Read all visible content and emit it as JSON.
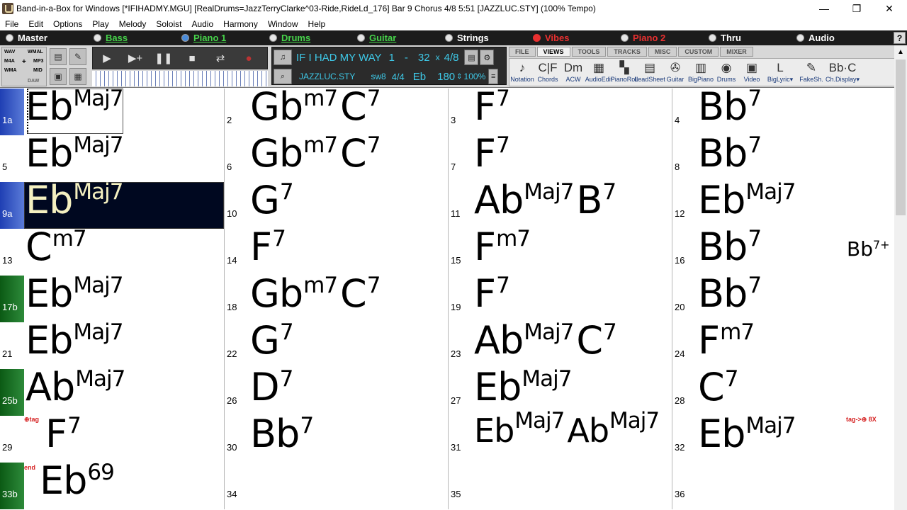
{
  "window": {
    "title": "Band-in-a-Box for Windows  [*IFIHADMY.MGU] [RealDrums=JazzTerryClarke^03-Ride,RideLd_176] Bar 9 Chorus 4/8   5:51  [JAZZLUC.STY] (100% Tempo)",
    "minimize": "—",
    "restore": "❐",
    "close": "✕"
  },
  "menu": [
    "File",
    "Edit",
    "Options",
    "Play",
    "Melody",
    "Soloist",
    "Audio",
    "Harmony",
    "Window",
    "Help"
  ],
  "tracks": [
    {
      "label": "Master",
      "color": "#ffffff",
      "state": "off"
    },
    {
      "label": "Bass",
      "color": "#46d24a",
      "state": "off"
    },
    {
      "label": "Piano 1",
      "color": "#46d24a",
      "state": "on"
    },
    {
      "label": "Drums",
      "color": "#46d24a",
      "state": "off"
    },
    {
      "label": "Guitar",
      "color": "#46d24a",
      "state": "off"
    },
    {
      "label": "Strings",
      "color": "#ffffff",
      "state": "off"
    },
    {
      "label": "Vibes",
      "color": "#e83030",
      "state": "red"
    },
    {
      "label": "Piano 2",
      "color": "#e83030",
      "state": "off"
    },
    {
      "label": "Thru",
      "color": "#ffffff",
      "state": "off"
    },
    {
      "label": "Audio",
      "color": "#ffffff",
      "state": "off"
    }
  ],
  "help_label": "?",
  "formats": {
    "wav": "WAV",
    "wmal": "WMAL",
    "m4a": "M4A",
    "plus": "+",
    "mp3": "MP3",
    "wma": "WMA",
    "mid": "MID",
    "daw": "DAW"
  },
  "song": {
    "title": "IF I HAD MY WAY",
    "start": "1",
    "dash": "-",
    "end": "32",
    "x": "x",
    "choruses": "4/8",
    "style": "JAZZLUC.STY",
    "feel": "sw8",
    "time_sig": "4/4",
    "key": "Eb",
    "tempo": "180",
    "tempo_pct": "100%"
  },
  "view_tabs": [
    "FILE",
    "VIEWS",
    "TOOLS",
    "TRACKS",
    "MISC",
    "CUSTOM",
    "MIXER"
  ],
  "active_view_tab": "VIEWS",
  "view_buttons": [
    {
      "label": "Notation",
      "glyph": "♪"
    },
    {
      "label": "Chords",
      "glyph": "C|F"
    },
    {
      "label": "ACW",
      "glyph": "Dm"
    },
    {
      "label": "AudioEdit",
      "glyph": "▦"
    },
    {
      "label": "PianoRoll",
      "glyph": "▚"
    },
    {
      "label": "LeadSheet",
      "glyph": "▤"
    },
    {
      "label": "Guitar",
      "glyph": "✇"
    },
    {
      "label": "BigPiano",
      "glyph": "▥"
    },
    {
      "label": "Drums",
      "glyph": "◉"
    },
    {
      "label": "Video",
      "glyph": "▣"
    },
    {
      "label": "BigLyric▾",
      "glyph": "L"
    },
    {
      "label": "FakeSh.",
      "glyph": "✎"
    },
    {
      "label": "Ch.Display▾",
      "glyph": "Bb·C"
    }
  ],
  "grid": {
    "rows": [
      {
        "section": "blue",
        "cells": [
          {
            "bar": "1a",
            "root": "Eb",
            "ext": "Maj7"
          },
          {
            "bar": "2",
            "root": "Gb",
            "ext": "m7",
            "root2": "C",
            "ext2": "7"
          },
          {
            "bar": "3",
            "root": "F",
            "ext": "7"
          },
          {
            "bar": "4",
            "root": "Bb",
            "ext": "7"
          }
        ]
      },
      {
        "section": "",
        "cells": [
          {
            "bar": "5",
            "root": "Eb",
            "ext": "Maj7"
          },
          {
            "bar": "6",
            "root": "Gb",
            "ext": "m7",
            "root2": "C",
            "ext2": "7"
          },
          {
            "bar": "7",
            "root": "F",
            "ext": "7"
          },
          {
            "bar": "8",
            "root": "Bb",
            "ext": "7"
          }
        ]
      },
      {
        "section": "blue",
        "highlight": true,
        "cells": [
          {
            "bar": "9a",
            "root": "Eb",
            "ext": "Maj7"
          },
          {
            "bar": "10",
            "root": "G",
            "ext": "7"
          },
          {
            "bar": "11",
            "root": "Ab",
            "ext": "Maj7",
            "root2": "B",
            "ext2": "7"
          },
          {
            "bar": "12",
            "root": "Eb",
            "ext": "Maj7"
          }
        ]
      },
      {
        "section": "",
        "cells": [
          {
            "bar": "13",
            "root": "C",
            "ext": "m7"
          },
          {
            "bar": "14",
            "root": "F",
            "ext": "7"
          },
          {
            "bar": "15",
            "root": "F",
            "ext": "m7"
          },
          {
            "bar": "16",
            "root": "Bb",
            "ext": "7"
          }
        ]
      },
      {
        "section": "green",
        "cells": [
          {
            "bar": "17b",
            "root": "Eb",
            "ext": "Maj7"
          },
          {
            "bar": "18",
            "root": "Gb",
            "ext": "m7",
            "root2": "C",
            "ext2": "7"
          },
          {
            "bar": "19",
            "root": "F",
            "ext": "7"
          },
          {
            "bar": "20",
            "root": "Bb",
            "ext": "7"
          }
        ]
      },
      {
        "section": "",
        "cells": [
          {
            "bar": "21",
            "root": "Eb",
            "ext": "Maj7"
          },
          {
            "bar": "22",
            "root": "G",
            "ext": "7"
          },
          {
            "bar": "23",
            "root": "Ab",
            "ext": "Maj7",
            "root2": "C",
            "ext2": "7"
          },
          {
            "bar": "24",
            "root": "F",
            "ext": "m7"
          }
        ]
      },
      {
        "section": "green",
        "cells": [
          {
            "bar": "25b",
            "root": "Ab",
            "ext": "Maj7"
          },
          {
            "bar": "26",
            "root": "D",
            "ext": "7"
          },
          {
            "bar": "27",
            "root": "Eb",
            "ext": "Maj7"
          },
          {
            "bar": "28",
            "root": "C",
            "ext": "7"
          }
        ]
      },
      {
        "section": "",
        "cells": [
          {
            "bar": "29",
            "root": "F",
            "ext": "7"
          },
          {
            "bar": "30",
            "root": "Bb",
            "ext": "7"
          },
          {
            "bar": "31",
            "root": "Eb",
            "ext": "Maj7",
            "root2": "Ab",
            "ext2": "Maj7"
          },
          {
            "bar": "32",
            "root": "Eb",
            "ext": "Maj7"
          }
        ]
      },
      {
        "section": "green",
        "cells": [
          {
            "bar": "33b",
            "root": "Eb",
            "ext": "69"
          },
          {
            "bar": "34",
            "root": "",
            "ext": ""
          },
          {
            "bar": "35",
            "root": "",
            "ext": ""
          },
          {
            "bar": "36",
            "root": "",
            "ext": ""
          }
        ]
      }
    ],
    "push_chord": {
      "root": "Bb",
      "ext": "7+"
    },
    "tag_start": "⊕tag",
    "tag_jump": "tag->⊕ 8X",
    "end_mark": "end"
  }
}
